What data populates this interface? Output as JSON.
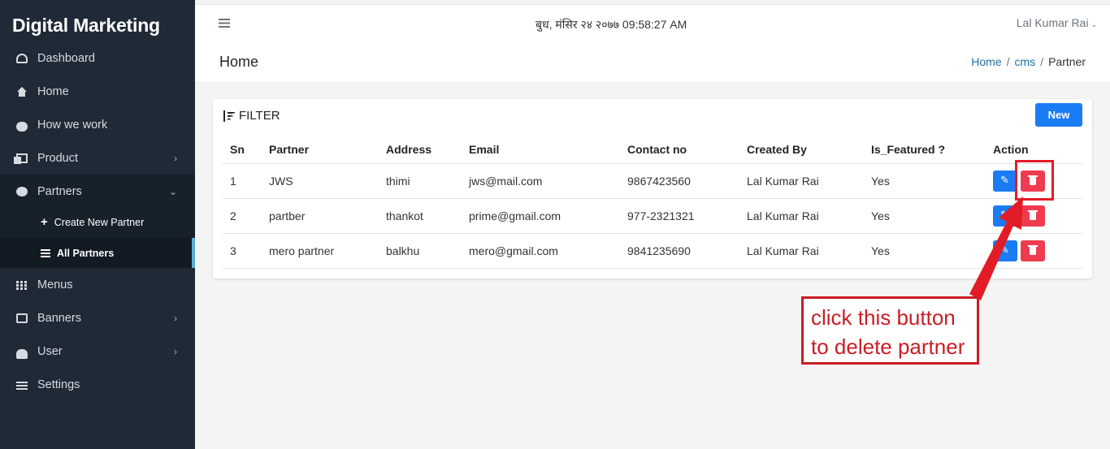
{
  "sidebar": {
    "brand": "Digital Marketing",
    "items": [
      {
        "label": "Dashboard",
        "icon": "dashboard-icon"
      },
      {
        "label": "Home",
        "icon": "home-icon"
      },
      {
        "label": "How we work",
        "icon": "handshake-icon"
      },
      {
        "label": "Product",
        "icon": "copy-icon",
        "chevron": "›"
      },
      {
        "label": "Partners",
        "icon": "user-circle-icon",
        "chevron": "⌄"
      },
      {
        "label": "Menus",
        "icon": "grid-icon"
      },
      {
        "label": "Banners",
        "icon": "image-icon",
        "chevron": "›"
      },
      {
        "label": "User",
        "icon": "users-icon",
        "chevron": "›"
      },
      {
        "label": "Settings",
        "icon": "sliders-icon"
      }
    ],
    "subitems": [
      {
        "label": "Create New Partner",
        "icon": "plus-icon"
      },
      {
        "label": "All Partners",
        "icon": "list-icon"
      }
    ]
  },
  "header": {
    "datetime": "बुध, मंसिर २४ २०७७ 09:58:27 AM",
    "user": "Lal Kumar Rai",
    "user_caret": "⌄"
  },
  "page": {
    "title": "Home",
    "breadcrumb": [
      "Home",
      "cms",
      "Partner"
    ],
    "breadcrumb_sep": "/"
  },
  "card": {
    "filter_label": "FILTER",
    "new_label": "New"
  },
  "table": {
    "headers": [
      "Sn",
      "Partner",
      "Address",
      "Email",
      "Contact no",
      "Created By",
      "Is_Featured ?",
      "Action"
    ],
    "rows": [
      {
        "sn": "1",
        "partner": "JWS",
        "address": "thimi",
        "email": "jws@mail.com",
        "contact": "9867423560",
        "created_by": "Lal Kumar Rai",
        "featured": "Yes"
      },
      {
        "sn": "2",
        "partner": "partber",
        "address": "thankot",
        "email": "prime@gmail.com",
        "contact": "977-2321321",
        "created_by": "Lal Kumar Rai",
        "featured": "Yes"
      },
      {
        "sn": "3",
        "partner": "mero partner",
        "address": "balkhu",
        "email": "mero@gmail.com",
        "contact": "9841235690",
        "created_by": "Lal Kumar Rai",
        "featured": "Yes"
      }
    ]
  },
  "annotation": {
    "line1": "click this button",
    "line2": "to delete partner",
    "color": "#c91d25"
  },
  "colors": {
    "sidebar_bg": "#1f2a36",
    "primary": "#1a7cf5",
    "danger": "#ef3b4f",
    "active_indicator": "#5ab0d8"
  }
}
